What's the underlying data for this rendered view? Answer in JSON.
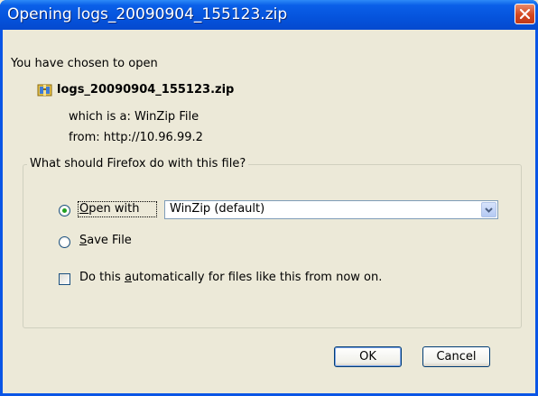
{
  "window": {
    "title": "Opening logs_20090904_155123.zip"
  },
  "info": {
    "chosen_text": "You have chosen to open",
    "filename": "logs_20090904_155123.zip",
    "which_is": "which is a:  WinZip File",
    "from": "from:  http://10.96.99.2"
  },
  "action": {
    "question": "What should Firefox do with this file?",
    "open_with_pre": "",
    "open_with_mnemonic": "O",
    "open_with_post": "pen with",
    "open_with_selected": true,
    "application_select_value": "WinZip (default)",
    "save_file_pre": "",
    "save_file_mnemonic": "S",
    "save_file_post": "ave File",
    "save_file_selected": false,
    "auto_pre": "Do this ",
    "auto_mnemonic": "a",
    "auto_post": "utomatically for files like this from now on.",
    "auto_checked": false
  },
  "buttons": {
    "ok": "OK",
    "cancel": "Cancel"
  },
  "icons": {
    "file": "winzip-file-icon",
    "close": "close-icon",
    "dropdown": "chevron-down-icon"
  },
  "colors": {
    "titlebar": "#0553DC",
    "dialog_bg": "#ECE9D8",
    "radio_selected": "#21A121",
    "close_button": "#D4471E"
  }
}
